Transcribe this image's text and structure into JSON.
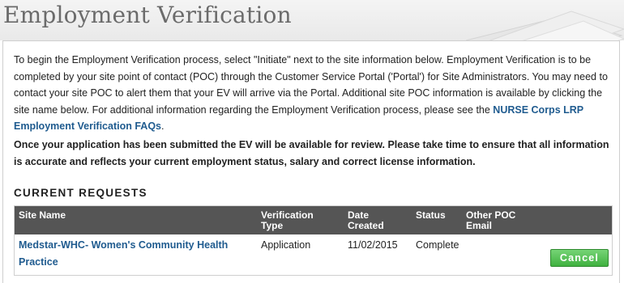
{
  "page": {
    "title": "Employment Verification"
  },
  "intro": {
    "text": "To begin the Employment Verification process, select \"Initiate\" next to the site information below. Employment Verification is to be completed by your site point of contact (POC) through the Customer Service Portal ('Portal') for Site Administrators. You may need to contact your site POC to alert them that your EV will arrive via the Portal. Additional site POC information is available by clicking the site name below. For additional information regarding the Employment Verification process, please see the ",
    "faq_link": "NURSE Corps LRP Employment Verification FAQs",
    "suffix": "."
  },
  "notice": "Once your application has been submitted the EV will be available for review. Please take time to ensure that all information is accurate and reflects your current employment status, salary and correct license information.",
  "current_requests": {
    "heading": "CURRENT REQUESTS",
    "columns": {
      "site_name": "Site Name",
      "verification_type_1": "Verification",
      "verification_type_2": "Type",
      "date_created_1": "Date",
      "date_created_2": "Created",
      "status": "Status",
      "other_poc_1": "Other POC",
      "other_poc_2": "Email"
    },
    "rows": [
      {
        "site_name": "Medstar-WHC- Women's Community Health Practice",
        "verification_type": "Application",
        "date_created": "11/02/2015",
        "status": "Complete",
        "other_poc_email": "",
        "action": "Cancel"
      }
    ]
  },
  "colors": {
    "link": "#1f5b8f",
    "header_bg": "#555555",
    "button": "#4cbb4c"
  }
}
